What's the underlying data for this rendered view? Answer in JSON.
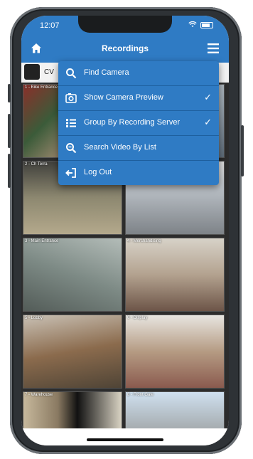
{
  "status": {
    "time": "12:07"
  },
  "nav": {
    "title": "Recordings"
  },
  "camera_header": {
    "name": "CV"
  },
  "tiles": [
    {
      "label": "1 - Bike Entrance"
    },
    {
      "label": ""
    },
    {
      "label": "2 - Ch Terra"
    },
    {
      "label": ""
    },
    {
      "label": "3 - Main Entrance"
    },
    {
      "label": "4 - Merchandising"
    },
    {
      "label": "5 - Lobby"
    },
    {
      "label": "6 - Display"
    },
    {
      "label": "7 - Warehouse"
    },
    {
      "label": "8 - Front Gate"
    }
  ],
  "menu": {
    "items": [
      {
        "label": "Find Camera",
        "icon": "search-icon",
        "checked": false
      },
      {
        "label": "Show Camera Preview",
        "icon": "camera-icon",
        "checked": true,
        "check": "✓"
      },
      {
        "label": "Group By Recording Server",
        "icon": "list-icon",
        "checked": true,
        "check": "✓"
      },
      {
        "label": "Search Video By List",
        "icon": "search-list-icon",
        "checked": false
      },
      {
        "label": "Log Out",
        "icon": "logout-icon",
        "checked": false
      }
    ]
  },
  "colors": {
    "accent": "#2f7bc4",
    "accent_dark": "#1e5f9e"
  }
}
